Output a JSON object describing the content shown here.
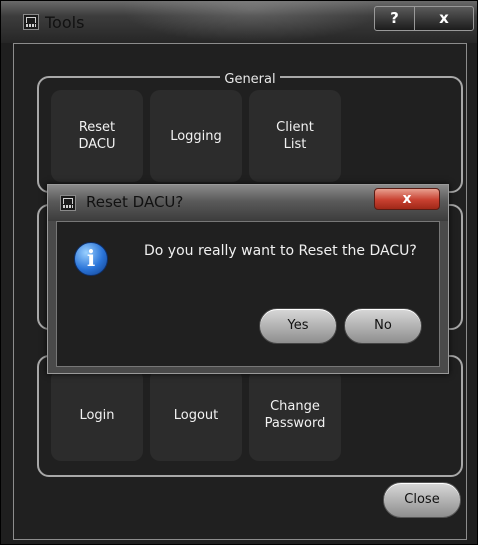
{
  "window": {
    "title": "Tools",
    "help_label": "?",
    "close_label": "x"
  },
  "groups": {
    "general": {
      "legend": "General",
      "tiles": [
        "Reset\nDACU",
        "Logging",
        "Client\nList"
      ]
    },
    "account": {
      "tiles": [
        "Login",
        "Logout",
        "Change\nPassword"
      ]
    }
  },
  "footer": {
    "close_label": "Close"
  },
  "dialog": {
    "title": "Reset DACU?",
    "close_label": "x",
    "message": "Do you really want to Reset the DACU?",
    "yes_label": "Yes",
    "no_label": "No",
    "icon": "info-icon"
  }
}
